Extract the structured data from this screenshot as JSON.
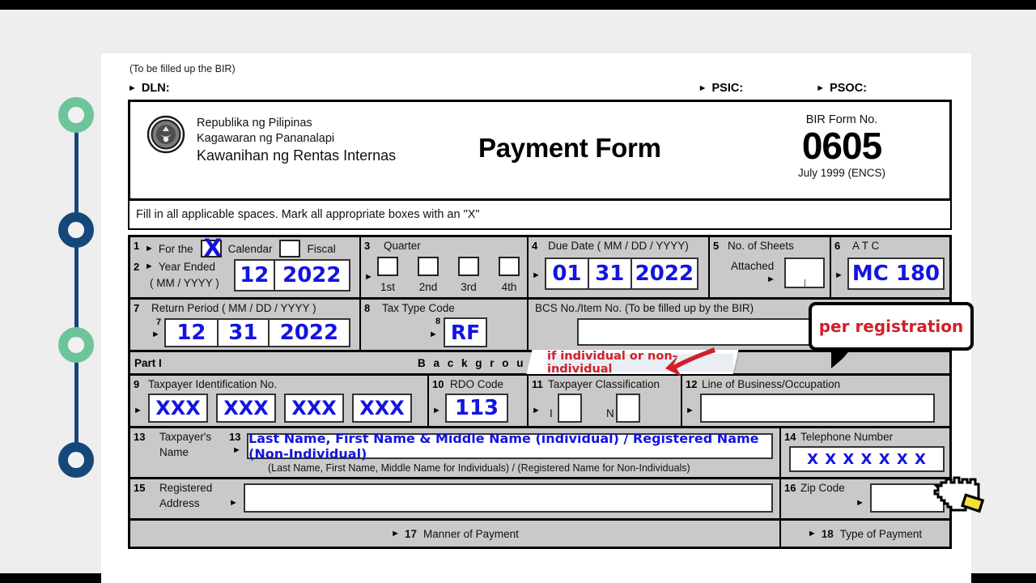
{
  "theme": {
    "page_bg": "#eeeeee",
    "accent_green": "#6cc49b",
    "accent_blue": "#14477a",
    "entry_blue": "#1414e0",
    "annotation_red": "#d0202a",
    "form_grey": "#c9c9c9"
  },
  "document": {
    "top_note": "(To be filled up the BIR)",
    "dln_label": "DLN:",
    "psic_label": "PSIC:",
    "psoc_label": "PSOC:",
    "agency": {
      "line1": "Republika ng Pilipinas",
      "line2": "Kagawaran ng Pananalapi",
      "line3": "Kawanihan ng Rentas Internas"
    },
    "title": "Payment Form",
    "form_no_caption": "BIR Form No.",
    "form_no": "0605",
    "revision": "July 1999 (ENCS)",
    "instruction": "Fill in all applicable spaces.  Mark all appropriate boxes with an \"X\""
  },
  "fields": {
    "f1": {
      "num": "1",
      "label": "For the",
      "calendar_label": "Calendar",
      "fiscal_label": "Fiscal",
      "calendar_checked": "X",
      "fiscal_checked": ""
    },
    "f2": {
      "num": "2",
      "label": "Year Ended",
      "sublabel": "(  MM / YYYY  )",
      "month": "12",
      "year": "2022"
    },
    "f3": {
      "num": "3",
      "label": "Quarter",
      "options": [
        "1st",
        "2nd",
        "3rd",
        "4th"
      ],
      "checked": ""
    },
    "f4": {
      "num": "4",
      "label": "Due Date ( MM / DD / YYYY)",
      "mm": "01",
      "dd": "31",
      "yyyy": "2022"
    },
    "f5": {
      "num": "5",
      "label": "No. of Sheets",
      "label2": "Attached",
      "value": ""
    },
    "f6": {
      "num": "6",
      "label": "A T C",
      "value": "MC 180"
    },
    "f7": {
      "num": "7",
      "label": "Return Period ( MM / DD / YYYY )",
      "mm": "12",
      "dd": "31",
      "yyyy": "2022"
    },
    "f8": {
      "num": "8",
      "label": "Tax Type Code",
      "value": "RF"
    },
    "bcs": {
      "label": "BCS No./Item No. (To be filled up by the  BIR)",
      "value": ""
    },
    "part1": {
      "part_label": "Part I",
      "background_label": "B a c k g r o u n d"
    },
    "f9": {
      "num": "9",
      "label": "Taxpayer Identification  No.",
      "groups": [
        "XXX",
        "XXX",
        "XXX",
        "XXX"
      ]
    },
    "f10": {
      "num": "10",
      "label": "RDO Code",
      "value": "113"
    },
    "f11": {
      "num": "11",
      "label": "Taxpayer Classification",
      "opt_i": "I",
      "opt_n": "N",
      "checked": ""
    },
    "f12": {
      "num": "12",
      "label": "Line of Business/Occupation",
      "value": ""
    },
    "f13": {
      "num": "13",
      "label_l1": "Taxpayer's",
      "label_l2": "Name",
      "inner_num": "13",
      "value": "Last Name, First Name & Middle Name (individual) / Registered Name (Non-Individual)",
      "footnote": "(Last Name, First Name, Middle Name for Individuals) / (Registered Name for Non-Individuals)"
    },
    "f14": {
      "num": "14",
      "label": "Telephone Number",
      "value": "X X X X X X X"
    },
    "f15": {
      "num": "15",
      "label_l1": "Registered",
      "label_l2": "Address",
      "value": ""
    },
    "f16": {
      "num": "16",
      "label": "Zip Code",
      "value": ""
    },
    "f17": {
      "num": "17",
      "label": "Manner of Payment"
    },
    "f18": {
      "num": "18",
      "label": "Type of Payment"
    }
  },
  "annotations": {
    "tab_note": "if individual or non-individual",
    "callout_note": "per registration"
  },
  "timeline": {
    "dots": [
      {
        "color": "green"
      },
      {
        "color": "blue"
      },
      {
        "color": "green"
      },
      {
        "color": "blue"
      }
    ]
  }
}
